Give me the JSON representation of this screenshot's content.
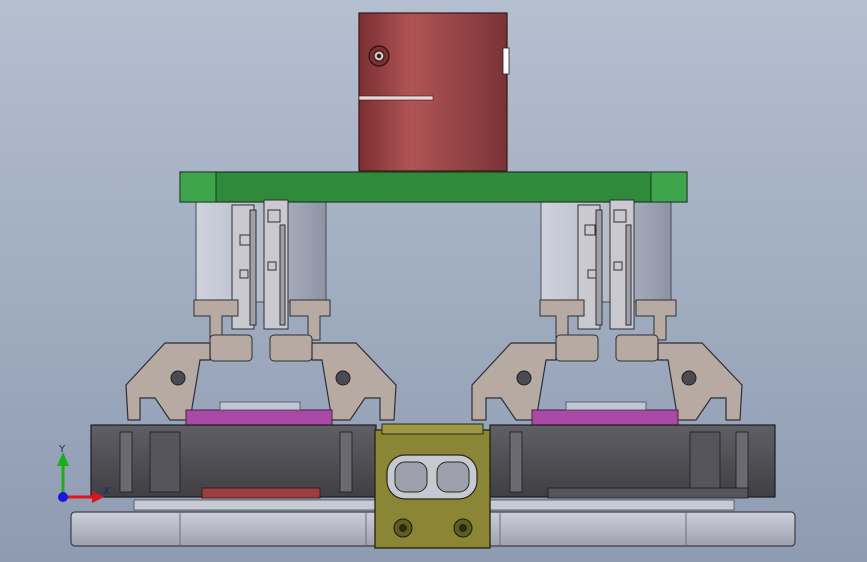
{
  "viewport": {
    "background_top": "#b4bfd0",
    "background_bottom": "#8e9bb1"
  },
  "triad": {
    "y_label": "Y",
    "x_label": "X",
    "y_color": "#18b018",
    "x_color": "#d81818",
    "z_color": "#1818e0"
  },
  "colors": {
    "motor_body": "#a5484a",
    "motor_dark": "#7a2f31",
    "plate_green": "#2f8a3c",
    "plate_green_light": "#3fa54c",
    "cylinder": "#b8bccb",
    "cylinder_dark": "#8e93a4",
    "gripper_arm": "#b6aaa2",
    "gripper_dark": "#7d726c",
    "bracket": "#c9c9cf",
    "base_dark": "#4b4b50",
    "base_mid": "#5c5c62",
    "purple": "#a84aa6",
    "center_block": "#8a8636",
    "center_block_dark": "#5f5c22",
    "base_plate": "#b5b7c2",
    "red_pad": "#9a3e40"
  }
}
